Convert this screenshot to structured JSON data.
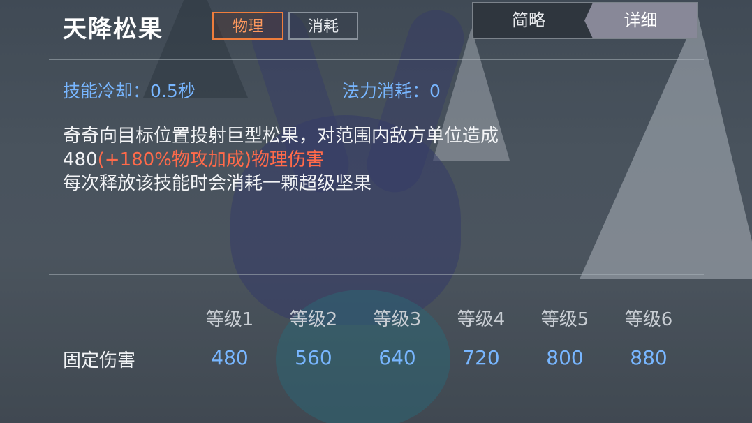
{
  "skill": {
    "name": "天降松果",
    "tags": [
      "物理",
      "消耗"
    ]
  },
  "view_toggle": {
    "brief": "简略",
    "detail": "详细",
    "selected": "详细"
  },
  "stats": {
    "cooldown": "技能冷却：0.5秒",
    "mana_cost": "法力消耗：0"
  },
  "description": {
    "line1": "奇奇向目标位置投射巨型松果，对范围内敌方单位造成",
    "line2_base": "480",
    "line2_highlight": "(+180%物攻加成)物理伤害",
    "line3": "每次释放该技能时会消耗一颗超级坚果"
  },
  "levels": {
    "headers": [
      "等级1",
      "等级2",
      "等级3",
      "等级4",
      "等级5",
      "等级6"
    ],
    "row_label": "固定伤害",
    "values": [
      "480",
      "560",
      "640",
      "720",
      "800",
      "880"
    ]
  },
  "colors": {
    "stat_blue": "#78b6ff",
    "highlight_red": "#ff6a4a",
    "physical_orange": "#ef7d3c"
  }
}
